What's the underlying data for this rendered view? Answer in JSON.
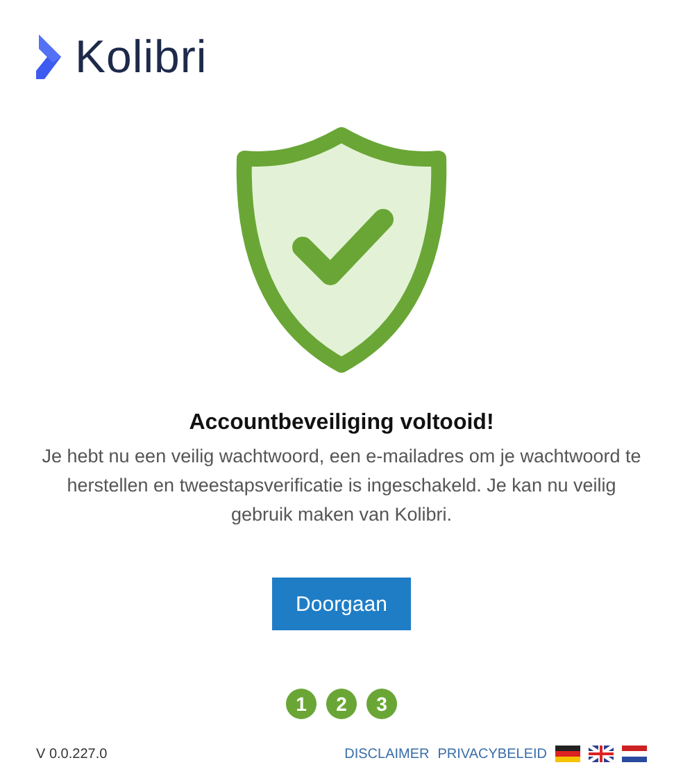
{
  "logo": {
    "name": "Kolibri"
  },
  "title": "Accountbeveiliging voltooid!",
  "message": "Je hebt nu een veilig wachtwoord, een e-mailadres om je wachtwoord te herstellen en tweestapsverificatie is ingeschakeld. Je kan nu veilig gebruik maken van Kolibri.",
  "button": "Doorgaan",
  "steps": [
    {
      "label": "1",
      "completed": true
    },
    {
      "label": "2",
      "completed": true
    },
    {
      "label": "3",
      "completed": true
    }
  ],
  "footer": {
    "version": "V 0.0.227.0",
    "links": [
      "DISCLAIMER",
      "PRIVACYBELEID"
    ],
    "languages": [
      {
        "kind": "de"
      },
      {
        "kind": "en"
      },
      {
        "kind": "nl"
      }
    ]
  }
}
